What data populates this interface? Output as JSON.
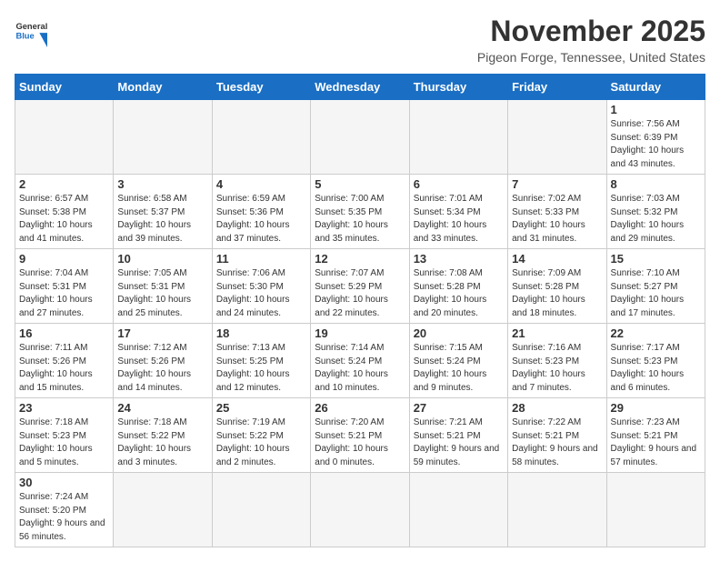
{
  "header": {
    "logo_general": "General",
    "logo_blue": "Blue",
    "month": "November 2025",
    "location": "Pigeon Forge, Tennessee, United States"
  },
  "weekdays": [
    "Sunday",
    "Monday",
    "Tuesday",
    "Wednesday",
    "Thursday",
    "Friday",
    "Saturday"
  ],
  "weeks": [
    [
      {
        "day": "",
        "info": ""
      },
      {
        "day": "",
        "info": ""
      },
      {
        "day": "",
        "info": ""
      },
      {
        "day": "",
        "info": ""
      },
      {
        "day": "",
        "info": ""
      },
      {
        "day": "",
        "info": ""
      },
      {
        "day": "1",
        "info": "Sunrise: 7:56 AM\nSunset: 6:39 PM\nDaylight: 10 hours and 43 minutes."
      }
    ],
    [
      {
        "day": "2",
        "info": "Sunrise: 6:57 AM\nSunset: 5:38 PM\nDaylight: 10 hours and 41 minutes."
      },
      {
        "day": "3",
        "info": "Sunrise: 6:58 AM\nSunset: 5:37 PM\nDaylight: 10 hours and 39 minutes."
      },
      {
        "day": "4",
        "info": "Sunrise: 6:59 AM\nSunset: 5:36 PM\nDaylight: 10 hours and 37 minutes."
      },
      {
        "day": "5",
        "info": "Sunrise: 7:00 AM\nSunset: 5:35 PM\nDaylight: 10 hours and 35 minutes."
      },
      {
        "day": "6",
        "info": "Sunrise: 7:01 AM\nSunset: 5:34 PM\nDaylight: 10 hours and 33 minutes."
      },
      {
        "day": "7",
        "info": "Sunrise: 7:02 AM\nSunset: 5:33 PM\nDaylight: 10 hours and 31 minutes."
      },
      {
        "day": "8",
        "info": "Sunrise: 7:03 AM\nSunset: 5:32 PM\nDaylight: 10 hours and 29 minutes."
      }
    ],
    [
      {
        "day": "9",
        "info": "Sunrise: 7:04 AM\nSunset: 5:31 PM\nDaylight: 10 hours and 27 minutes."
      },
      {
        "day": "10",
        "info": "Sunrise: 7:05 AM\nSunset: 5:31 PM\nDaylight: 10 hours and 25 minutes."
      },
      {
        "day": "11",
        "info": "Sunrise: 7:06 AM\nSunset: 5:30 PM\nDaylight: 10 hours and 24 minutes."
      },
      {
        "day": "12",
        "info": "Sunrise: 7:07 AM\nSunset: 5:29 PM\nDaylight: 10 hours and 22 minutes."
      },
      {
        "day": "13",
        "info": "Sunrise: 7:08 AM\nSunset: 5:28 PM\nDaylight: 10 hours and 20 minutes."
      },
      {
        "day": "14",
        "info": "Sunrise: 7:09 AM\nSunset: 5:28 PM\nDaylight: 10 hours and 18 minutes."
      },
      {
        "day": "15",
        "info": "Sunrise: 7:10 AM\nSunset: 5:27 PM\nDaylight: 10 hours and 17 minutes."
      }
    ],
    [
      {
        "day": "16",
        "info": "Sunrise: 7:11 AM\nSunset: 5:26 PM\nDaylight: 10 hours and 15 minutes."
      },
      {
        "day": "17",
        "info": "Sunrise: 7:12 AM\nSunset: 5:26 PM\nDaylight: 10 hours and 14 minutes."
      },
      {
        "day": "18",
        "info": "Sunrise: 7:13 AM\nSunset: 5:25 PM\nDaylight: 10 hours and 12 minutes."
      },
      {
        "day": "19",
        "info": "Sunrise: 7:14 AM\nSunset: 5:24 PM\nDaylight: 10 hours and 10 minutes."
      },
      {
        "day": "20",
        "info": "Sunrise: 7:15 AM\nSunset: 5:24 PM\nDaylight: 10 hours and 9 minutes."
      },
      {
        "day": "21",
        "info": "Sunrise: 7:16 AM\nSunset: 5:23 PM\nDaylight: 10 hours and 7 minutes."
      },
      {
        "day": "22",
        "info": "Sunrise: 7:17 AM\nSunset: 5:23 PM\nDaylight: 10 hours and 6 minutes."
      }
    ],
    [
      {
        "day": "23",
        "info": "Sunrise: 7:18 AM\nSunset: 5:23 PM\nDaylight: 10 hours and 5 minutes."
      },
      {
        "day": "24",
        "info": "Sunrise: 7:18 AM\nSunset: 5:22 PM\nDaylight: 10 hours and 3 minutes."
      },
      {
        "day": "25",
        "info": "Sunrise: 7:19 AM\nSunset: 5:22 PM\nDaylight: 10 hours and 2 minutes."
      },
      {
        "day": "26",
        "info": "Sunrise: 7:20 AM\nSunset: 5:21 PM\nDaylight: 10 hours and 0 minutes."
      },
      {
        "day": "27",
        "info": "Sunrise: 7:21 AM\nSunset: 5:21 PM\nDaylight: 9 hours and 59 minutes."
      },
      {
        "day": "28",
        "info": "Sunrise: 7:22 AM\nSunset: 5:21 PM\nDaylight: 9 hours and 58 minutes."
      },
      {
        "day": "29",
        "info": "Sunrise: 7:23 AM\nSunset: 5:21 PM\nDaylight: 9 hours and 57 minutes."
      }
    ],
    [
      {
        "day": "30",
        "info": "Sunrise: 7:24 AM\nSunset: 5:20 PM\nDaylight: 9 hours and 56 minutes."
      },
      {
        "day": "",
        "info": ""
      },
      {
        "day": "",
        "info": ""
      },
      {
        "day": "",
        "info": ""
      },
      {
        "day": "",
        "info": ""
      },
      {
        "day": "",
        "info": ""
      },
      {
        "day": "",
        "info": ""
      }
    ]
  ]
}
